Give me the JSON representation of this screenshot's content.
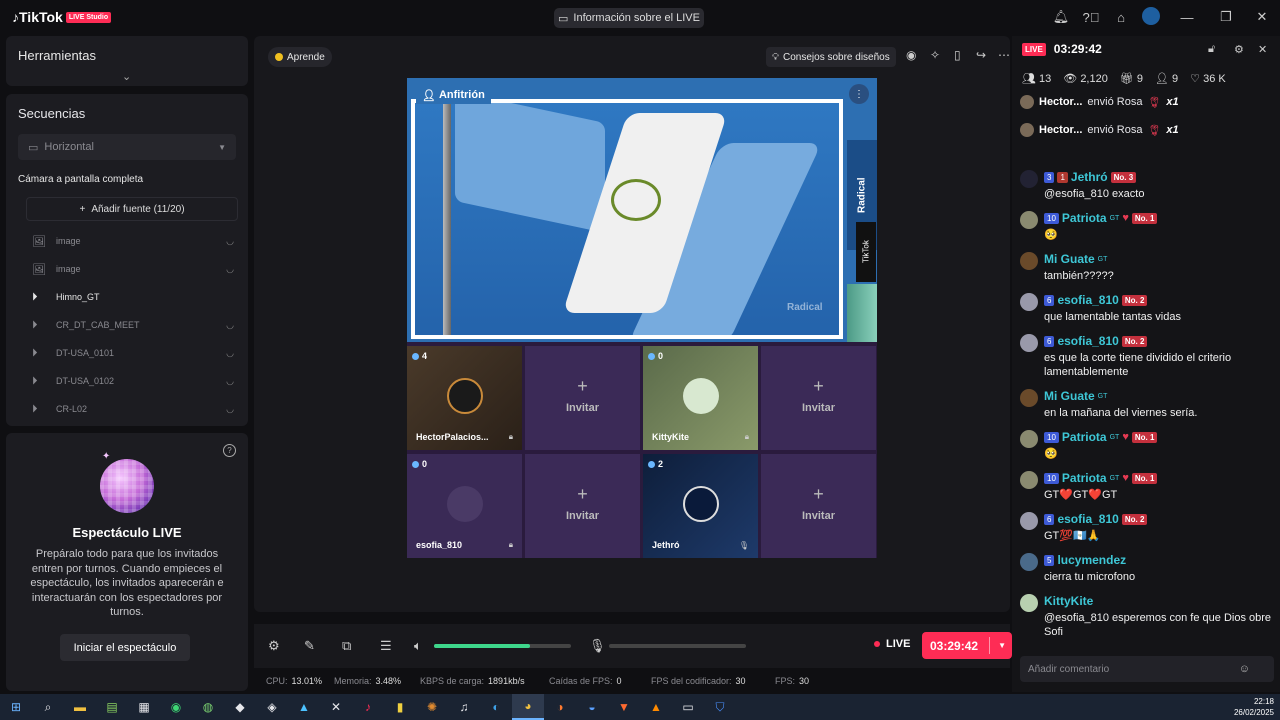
{
  "app": {
    "name": "TikTok",
    "badge": "LIVE Studio",
    "info_button": "Información sobre el LIVE"
  },
  "left": {
    "tools_title": "Herramientas",
    "sequences_title": "Secuencias",
    "orientation": "Horizontal",
    "camera_label": "Cámara a pantalla completa",
    "add_source": "Añadir fuente (11/20)",
    "sources": [
      {
        "label": "image",
        "icon": "image-icon"
      },
      {
        "label": "image",
        "icon": "image-icon"
      },
      {
        "label": "Himno_GT",
        "icon": "play-circle-icon"
      },
      {
        "label": "CR_DT_CAB_MEET",
        "icon": "play-circle-icon"
      },
      {
        "label": "DT-USA_0101",
        "icon": "play-circle-icon"
      },
      {
        "label": "DT-USA_0102",
        "icon": "play-circle-icon"
      },
      {
        "label": "CR-L02",
        "icon": "play-circle-icon"
      }
    ],
    "show_title": "Espectáculo LIVE",
    "show_desc": "Prepáralo todo para que los invitados entren por turnos. Cuando empieces el espectáculo, los invitados aparecerán e interactuarán con los espectadores por turnos.",
    "show_button": "Iniciar el espectáculo"
  },
  "center": {
    "learn": "Aprende",
    "tips": "Consejos sobre diseños",
    "host_tag": "Anfitrión",
    "side_brand": "Radical",
    "side_tiktok": "TikTok",
    "watermark": "Radical",
    "guests": [
      {
        "type": "guest",
        "count": "4",
        "name": "HectorPalacios..."
      },
      {
        "type": "invite",
        "label": "Invitar"
      },
      {
        "type": "guest",
        "count": "0",
        "name": "KittyKite"
      },
      {
        "type": "invite",
        "label": "Invitar"
      },
      {
        "type": "guest",
        "count": "0",
        "name": "esofia_810"
      },
      {
        "type": "invite",
        "label": "Invitar"
      },
      {
        "type": "guest",
        "count": "2",
        "name": "Jethró"
      },
      {
        "type": "invite",
        "label": "Invitar"
      }
    ]
  },
  "bottom": {
    "volume": 0.7,
    "live_label": "LIVE",
    "timer": "03:29:42",
    "stats": [
      {
        "label": "CPU:",
        "value": "13.01%"
      },
      {
        "label": "Memoria:",
        "value": "3.48%"
      },
      {
        "label": "KBPS de carga:",
        "value": "1891kb/s"
      },
      {
        "label": "Caídas de FPS:",
        "value": "0"
      },
      {
        "label": "FPS del codificador:",
        "value": "30"
      },
      {
        "label": "FPS:",
        "value": "30"
      }
    ]
  },
  "chat": {
    "live_badge": "LIVE",
    "time": "03:29:42",
    "stats": {
      "users": "13",
      "views": "2,120",
      "gifts": "9",
      "follows": "9",
      "likes": "36 K"
    },
    "gifts": [
      {
        "user": "Hector...",
        "text": "envió Rosa",
        "mult": "x1"
      },
      {
        "user": "Hector...",
        "text": "envió Rosa",
        "mult": "x1"
      }
    ],
    "messages": [
      {
        "user": "Jethró",
        "level": "3",
        "fan": "1",
        "rank": "No. 3",
        "text": "@esofia_810 exacto"
      },
      {
        "user": "Patriota",
        "suffix": "GT",
        "level": "10",
        "rank": "No. 1",
        "text": "🥺"
      },
      {
        "user": "Mi Guate",
        "suffix": "GT",
        "text": "también?????"
      },
      {
        "user": "esofia_810",
        "level": "6",
        "rank": "No. 2",
        "text": "que lamentable tantas vidas"
      },
      {
        "user": "esofia_810",
        "level": "6",
        "rank": "No. 2",
        "text": "es que la corte tiene dividido el criterio lamentablemente"
      },
      {
        "user": "Mi Guate",
        "suffix": "GT",
        "text": "en la mañana del viernes sería."
      },
      {
        "user": "Patriota",
        "suffix": "GT",
        "level": "10",
        "rank": "No. 1",
        "text": "🥺"
      },
      {
        "user": "Patriota",
        "suffix": "GT",
        "level": "10",
        "rank": "No. 1",
        "text": "GT❤️GT❤️GT"
      },
      {
        "user": "esofia_810",
        "level": "6",
        "rank": "No. 2",
        "text": "GT💯🇬🇹🙏"
      },
      {
        "user": "lucymendez",
        "level": "5",
        "text": "cierra tu microfono"
      },
      {
        "user": "KittyKite",
        "text": "@esofia_810 esperemos con fe que Dios obre Sofi"
      }
    ],
    "input_placeholder": "Añadir comentario"
  },
  "taskbar": {
    "time": "22:18",
    "date": "26/02/2025"
  }
}
